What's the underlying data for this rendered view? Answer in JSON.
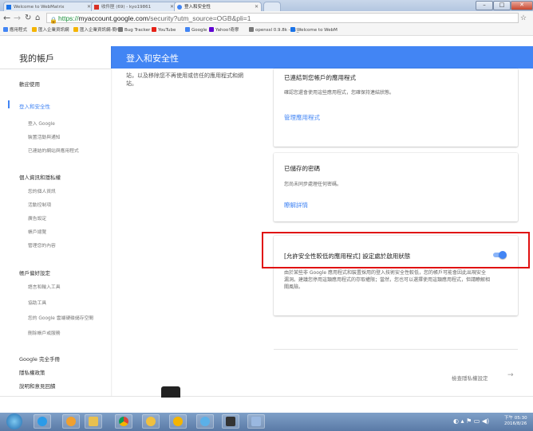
{
  "browser": {
    "tabs": [
      {
        "label": "Welcome to WebMatrix"
      },
      {
        "label": "收件匣 (69) - kyo19861"
      },
      {
        "label": "登入和安全性"
      }
    ],
    "url_scheme": "https://",
    "url_host": "myaccount.google.com",
    "url_path": "/security?utm_source=OGB&pli=1",
    "bookmarks": [
      {
        "label": "應用程式",
        "color": "#4285f4"
      },
      {
        "label": "匯入企業資訊網",
        "color": "#f4b400"
      },
      {
        "label": "匯入企業資訊網-簡中",
        "color": "#f4b400"
      },
      {
        "label": "Bug Tracker",
        "color": "#777777"
      },
      {
        "label": "YouTube",
        "color": "#e62117"
      },
      {
        "label": "Google",
        "color": "#4285f4"
      },
      {
        "label": "Yahoo!奇摩",
        "color": "#6001d2"
      },
      {
        "label": "openssl 0.9.8k - ec_",
        "color": "#777777"
      },
      {
        "label": "Welcome to WebM",
        "color": "#1a73e8"
      }
    ]
  },
  "header": {
    "account": "我的帳戶",
    "title": "登入和安全性"
  },
  "sidebar": {
    "welcome": "歡迎使用",
    "security": "登入和安全性",
    "security_items": [
      "登入 Google",
      "裝置活動與通知",
      "已連結的網站與應用程式"
    ],
    "privacy": "個人資訊和隱私權",
    "privacy_items": [
      "您的個人資訊",
      "活動控制項",
      "廣告設定",
      "帳戶總覽",
      "管理您的內容"
    ],
    "prefs": "帳戶偏好設定",
    "prefs_items": [
      "語言和輸入工具",
      "協助工具",
      "您的 Google 雲端硬碟儲存空間",
      "刪除帳戶或服務"
    ],
    "footer": [
      "Google 完全手冊",
      "隱私權政策",
      "說明和意見回饋"
    ]
  },
  "main": {
    "top_left_text": "站，以及移除您不再使用或信任的應用程式和網站。",
    "connected_apps": {
      "title": "已連結到您帳戶的應用程式",
      "desc": "確認您還會使用這些應用程式，您確保持連結狀態。",
      "link": "管理應用程式"
    },
    "saved_passwords": {
      "title": "已儲存的密碼",
      "desc": "您尚未同步處理任何密碼。",
      "link": "瞭解詳情"
    },
    "less_secure": {
      "title": "[允許安全性較低的應用程式] 設定處於啟用狀態",
      "desc": "由於某些非 Google 應用程式和裝置採用的登入技術安全性較低，您的帳戶可能會因此出現安全漏洞。建議您停用這類應用程式的存取權限；當然，您也可以選擇使用這類應用程式，但請瞭解相關風險。",
      "enabled": true
    },
    "review_link": "檢查隱私權設定",
    "review_arrow": "→"
  },
  "taskbar": {
    "time": "下午 05:30",
    "date": "2016/8/26"
  }
}
